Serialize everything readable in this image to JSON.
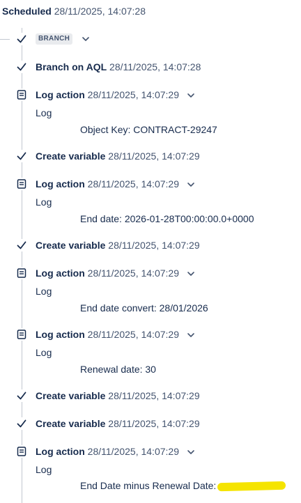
{
  "header": {
    "status": "Scheduled",
    "timestamp": "28/11/2025, 14:07:28"
  },
  "branch": {
    "badge": "BRANCH"
  },
  "steps": [
    {
      "title": "Branch on AQL",
      "time": "28/11/2025, 14:07:28",
      "icon": "check-icon"
    },
    {
      "title": "Log action",
      "time": "28/11/2025, 14:07:29",
      "icon": "log-icon",
      "log_label": "Log",
      "message": "Object Key: CONTRACT-29247"
    },
    {
      "title": "Create variable",
      "time": "28/11/2025, 14:07:29",
      "icon": "check-icon"
    },
    {
      "title": "Log action",
      "time": "28/11/2025, 14:07:29",
      "icon": "log-icon",
      "log_label": "Log",
      "message": "End date: 2026-01-28T00:00:00.0+0000"
    },
    {
      "title": "Create variable",
      "time": "28/11/2025, 14:07:29",
      "icon": "check-icon"
    },
    {
      "title": "Log action",
      "time": "28/11/2025, 14:07:29",
      "icon": "log-icon",
      "log_label": "Log",
      "message": "End date convert: 28/01/2026"
    },
    {
      "title": "Log action",
      "time": "28/11/2025, 14:07:29",
      "icon": "log-icon",
      "log_label": "Log",
      "message": "Renewal date: 30"
    },
    {
      "title": "Create variable",
      "time": "28/11/2025, 14:07:29",
      "icon": "check-icon"
    },
    {
      "title": "Create variable",
      "time": "28/11/2025, 14:07:29",
      "icon": "check-icon"
    },
    {
      "title": "Log action",
      "time": "28/11/2025, 14:07:29",
      "icon": "log-icon",
      "log_label": "Log",
      "message": "End Date minus Renewal Date:"
    }
  ],
  "colors": {
    "text": "#172b4d",
    "muted": "#44546f",
    "line": "#c1c7d0",
    "highlight": "#f5e400"
  }
}
